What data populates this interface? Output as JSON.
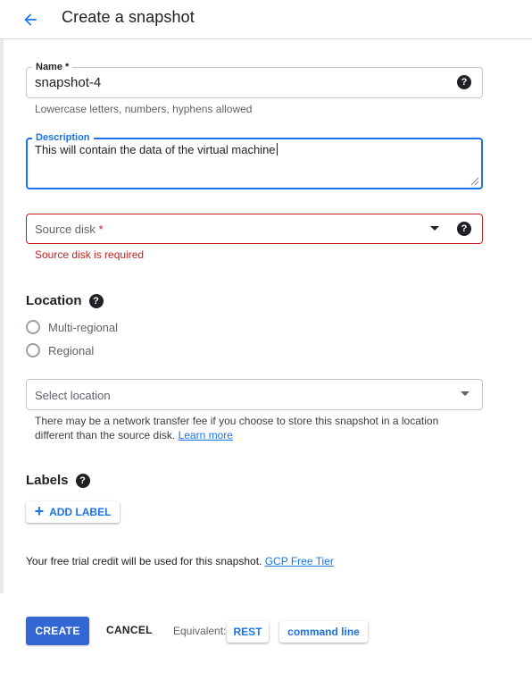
{
  "header": {
    "title": "Create a snapshot"
  },
  "form": {
    "name": {
      "label": "Name *",
      "value": "snapshot-4",
      "hint": "Lowercase letters, numbers, hyphens allowed"
    },
    "description": {
      "label": "Description",
      "value": "This will contain the data of the virtual machine"
    },
    "source_disk": {
      "label": "Source disk",
      "required_mark": "*",
      "error": "Source disk is required"
    },
    "location": {
      "title": "Location",
      "options": [
        "Multi-regional",
        "Regional"
      ],
      "select_placeholder": "Select location",
      "note": "There may be a network transfer fee if you choose to store this snapshot in a location different than the source disk.",
      "learn_more": "Learn more"
    },
    "labels": {
      "title": "Labels",
      "add_button": "ADD LABEL"
    },
    "trial": {
      "text": "Your free trial credit will be used for this snapshot.",
      "link": "GCP Free Tier"
    }
  },
  "actions": {
    "create": "CREATE",
    "cancel": "CANCEL",
    "equivalent_label": "Equivalent:",
    "rest": "REST",
    "command_line": "command line"
  },
  "icons": {
    "back": "arrow-back-icon",
    "help": "help-circle-icon",
    "dropdown": "arrow-drop-down-icon",
    "plus": "plus-icon"
  },
  "colors": {
    "accent": "#1a73e8",
    "primary_button": "#3367d6",
    "error": "#c5221f",
    "text": "#202124",
    "secondary_text": "#5f6368"
  }
}
